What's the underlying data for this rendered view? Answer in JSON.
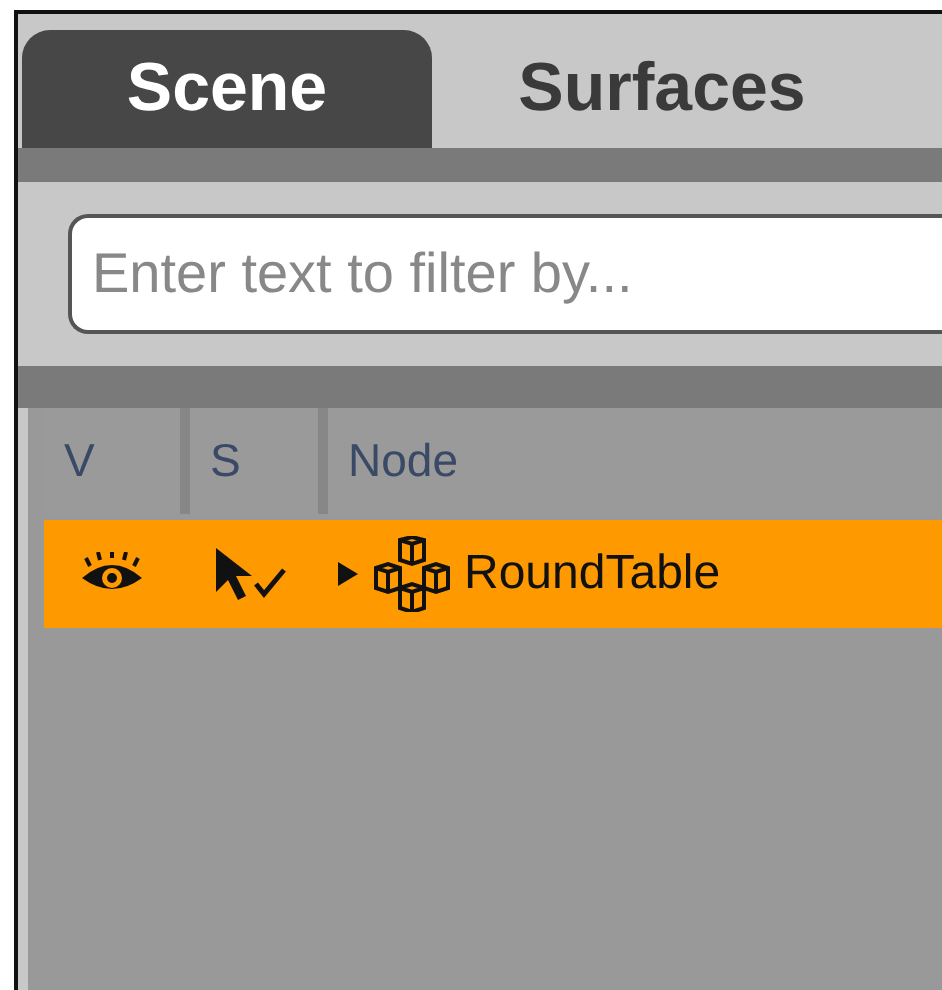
{
  "tabs": [
    {
      "label": "Scene",
      "selected": true
    },
    {
      "label": "Surfaces",
      "selected": false
    }
  ],
  "filter": {
    "placeholder": "Enter text to filter by..."
  },
  "table": {
    "columns": [
      "V",
      "S",
      "Node"
    ],
    "rows": [
      {
        "name": "RoundTable",
        "selected": true,
        "visible": true,
        "expanded": false
      }
    ]
  }
}
